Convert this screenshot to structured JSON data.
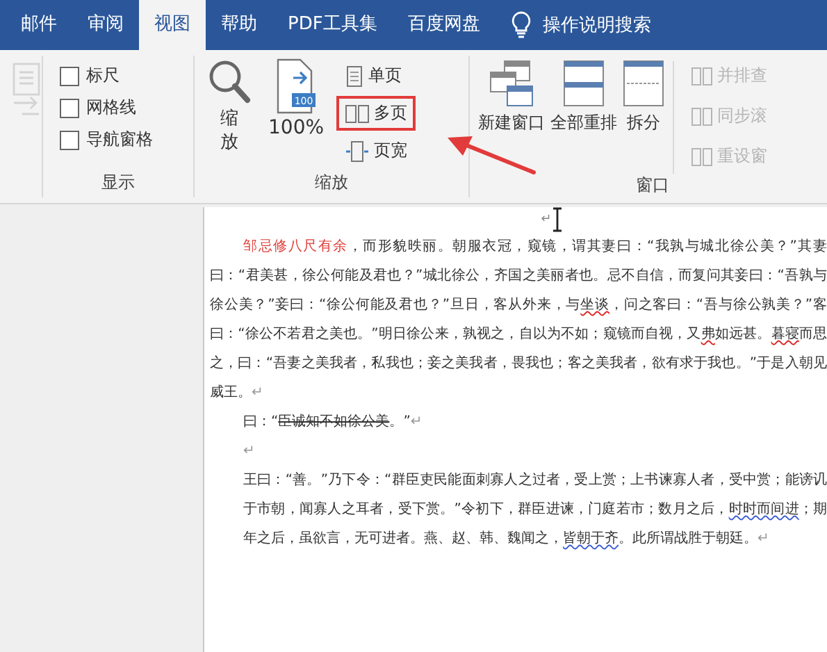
{
  "tabs": [
    {
      "label": "邮件",
      "selected": false
    },
    {
      "label": "审阅",
      "selected": false
    },
    {
      "label": "视图",
      "selected": true
    },
    {
      "label": "帮助",
      "selected": false
    },
    {
      "label": "PDF工具集",
      "selected": false
    },
    {
      "label": "百度网盘",
      "selected": false
    }
  ],
  "tell_me": {
    "label": "操作说明搜索"
  },
  "show_group": {
    "label": "显示",
    "checkboxes": [
      {
        "label": "标尺",
        "checked": false
      },
      {
        "label": "网格线",
        "checked": false
      },
      {
        "label": "导航窗格",
        "checked": false
      }
    ]
  },
  "zoom_group": {
    "label": "缩放",
    "zoom_button": {
      "label": "缩放"
    },
    "hundred_button": {
      "label": "100%",
      "icon_text": "100"
    },
    "views": [
      {
        "label": "单页",
        "highlighted": false
      },
      {
        "label": "多页",
        "highlighted": true
      },
      {
        "label": "页宽",
        "highlighted": false
      }
    ]
  },
  "window_group": {
    "label": "窗口",
    "buttons": [
      {
        "label": "新建窗口",
        "kind": "new"
      },
      {
        "label": "全部重排",
        "kind": "arrange"
      },
      {
        "label": "拆分",
        "kind": "split"
      }
    ],
    "small_buttons": [
      {
        "label": "并排查",
        "disabled": true
      },
      {
        "label": "同步滚",
        "disabled": true
      },
      {
        "label": "重设窗",
        "disabled": true
      }
    ]
  },
  "document": {
    "header_mark": "↵",
    "paragraphs": [
      {
        "kind": "first-line",
        "end_mark": "↵",
        "segments": [
          {
            "kind": "marked",
            "text": "邹忌修八尺有余"
          },
          {
            "kind": "plain",
            "text": "，而形貌昳丽。朝服衣冠，窥镜，谓其妻曰：“我孰与城北徐公美？”其妻曰：“君美甚，徐公何能及君也？”城北徐公，齐国之美丽者也。忌不自信，而复问其妾曰：“吾孰与徐公美？”妾曰：“徐公何能及君也？”旦日，客从外来，与"
          },
          {
            "kind": "spell",
            "text": "坐谈"
          },
          {
            "kind": "plain",
            "text": "，问之客曰：“吾与徐公孰美？”客曰：“徐公不若君之美也。”明日徐公来，孰视之，自以为不如；窥镜而自视，又"
          },
          {
            "kind": "spell",
            "text": "弗"
          },
          {
            "kind": "plain",
            "text": "如远甚。"
          },
          {
            "kind": "spell",
            "text": "暮寝"
          },
          {
            "kind": "plain",
            "text": "而思之，曰：“吾妻之美我者，私我也；妾之美我者，畏我也；客之美我者，欲有求于我也。”于是入朝见威王。"
          }
        ]
      },
      {
        "kind": "block",
        "end_mark": "↵",
        "segments": [
          {
            "kind": "plain",
            "text": "曰：“"
          },
          {
            "kind": "struck",
            "text": "臣诚知不如徐公美"
          },
          {
            "kind": "plain",
            "text": "。”"
          }
        ]
      },
      {
        "kind": "block",
        "end_mark": "↵"
      },
      {
        "kind": "block",
        "end_mark": "↵",
        "segments": [
          {
            "kind": "plain",
            "text": "王曰：“善。”乃下令：“群臣吏民能面刺寡人之过者，受上赏；上书谏寡人者，受中赏；能谤讥于市朝，闻寡人之耳者，受下赏。”令初下，群臣进谏，门庭若市；数月之后，"
          },
          {
            "kind": "grammar",
            "text": "时时而间进"
          },
          {
            "kind": "plain",
            "text": "；期年之后，虽欲言，无可进者。燕、赵、韩、魏闻之，"
          },
          {
            "kind": "grammar",
            "text": "皆朝于齐"
          },
          {
            "kind": "plain",
            "text": "。此所谓战胜于朝廷。"
          }
        ]
      }
    ]
  }
}
